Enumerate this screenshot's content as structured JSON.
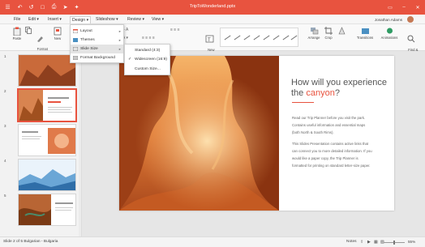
{
  "window": {
    "title": "TripToWonderland.pptx",
    "user_name": "Jonathan Adams"
  },
  "menubar": [
    "File",
    "Edit ▾",
    "Insert ▾",
    "Design ▾",
    "Slideshow ▾",
    "Review ▾",
    "View ▾"
  ],
  "ribbon": {
    "paste": "Paste",
    "format_painter": "Format\nPainter",
    "new_slide": "New",
    "new_text_box": "New\nText Box",
    "arrange": "Arrange",
    "crop": "Crop",
    "transitions": "Transitions",
    "animations": "Animations",
    "find_replace": "Find &\nReplace"
  },
  "design_menu": {
    "items": [
      "Layout",
      "Themes",
      "Slide Size",
      "Format Background"
    ]
  },
  "slide_size_menu": {
    "items": [
      "Standard (4:3)",
      "Widescreen (16:9)",
      "Custom Size..."
    ],
    "checked": "Widescreen (16:9)"
  },
  "thumbnails": {
    "numbers": [
      "1",
      "2",
      "3",
      "4",
      "5"
    ],
    "selected": "2"
  },
  "slide": {
    "title_line1": "How will you experience",
    "title_the": "the ",
    "title_accent": "canyon",
    "title_end": "?",
    "body": [
      "Read our Trip Planner before you visit the park.",
      "Contains useful information and essential maps",
      "(both North & South Rims).",
      "This Slides Presentation contains active links that",
      "can connect you to more detailed information. If you",
      "would like a paper copy, the Trip Planner is",
      "formatted for printing on standard letter-size paper."
    ]
  },
  "statusbar": {
    "left": "Slide 2 of 5   Bulgarian - Bulgaria",
    "notes": "Notes",
    "zoom": "55%"
  },
  "colors": {
    "accent": "#e8533f",
    "titlebar": "#e8533f"
  }
}
